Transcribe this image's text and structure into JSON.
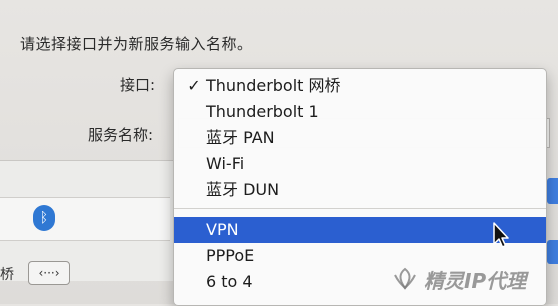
{
  "dialog": {
    "prompt": "请选择接口并为新服务输入名称。",
    "interface_label": "接口:",
    "service_name_label": "服务名称:"
  },
  "popup_menu": {
    "items": [
      {
        "label": "Thunderbolt 网桥",
        "checked": true
      },
      {
        "label": "Thunderbolt 1"
      },
      {
        "label": "蓝牙 PAN"
      },
      {
        "label": "Wi-Fi"
      },
      {
        "label": "蓝牙 DUN"
      },
      {
        "label": "VPN",
        "highlighted": true
      },
      {
        "label": "PPPoE"
      },
      {
        "label": "6 to 4"
      }
    ],
    "check_glyph": "✓"
  },
  "background": {
    "bottom_label": "桥",
    "bottom_button": "‹···›"
  },
  "watermark": {
    "text": "精灵IP代理"
  },
  "colors": {
    "highlight": "#2b5fd0",
    "bluetooth": "#2f78d3"
  }
}
